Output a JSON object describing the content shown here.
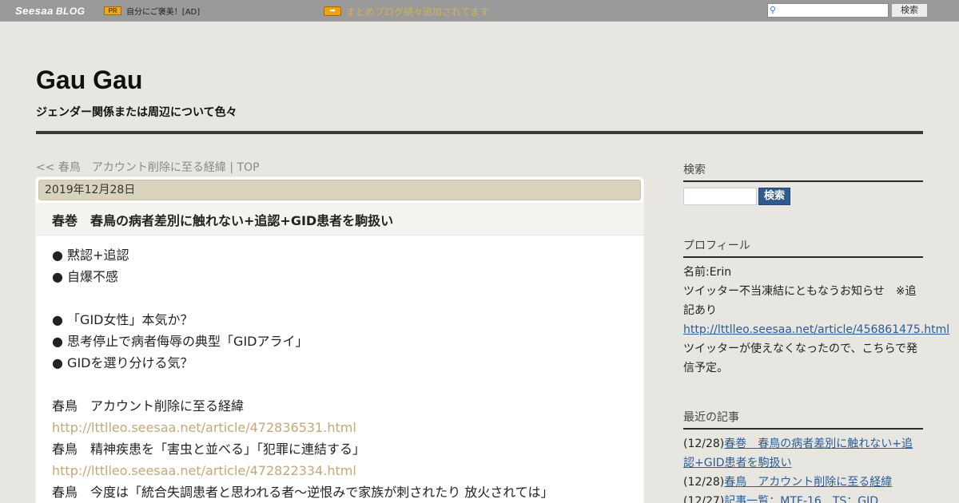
{
  "topbar": {
    "logo_main": "Seesaa",
    "logo_sub": "BLOG",
    "pr_label": "PR",
    "ad_text": "自分にご褒美！[AD]",
    "arrow_label": "➡",
    "notice": "まとめブログ続々追加されてます",
    "search_button": "検索",
    "search_value": ""
  },
  "header": {
    "title": "Gau Gau",
    "description": "ジェンダー関係または周辺について色々"
  },
  "nav": {
    "prev": "<< 春鳥　アカウント削除に至る経緯",
    "separator": " | ",
    "top": "TOP"
  },
  "article": {
    "date": "2019年12月28日",
    "title": "春巻　春鳥の病者差別に触れない+追認+GID患者を駒扱い",
    "lines": [
      {
        "text": "● 黙認+追認",
        "link": false
      },
      {
        "text": "● 自爆不感",
        "link": false
      },
      {
        "text": "",
        "link": false
      },
      {
        "text": "● 「GID女性」本気か？",
        "link": false
      },
      {
        "text": "● 思考停止で病者侮辱の典型「GIDアライ」",
        "link": false
      },
      {
        "text": "● GIDを選り分ける気？",
        "link": false
      },
      {
        "text": "",
        "link": false
      },
      {
        "text": "春鳥　アカウント削除に至る経緯",
        "link": false
      },
      {
        "text": "http://lttlleo.seesaa.net/article/472836531.html",
        "link": true
      },
      {
        "text": "春鳥　精神疾患を「害虫と並べる」「犯罪に連結する」",
        "link": false
      },
      {
        "text": "http://lttlleo.seesaa.net/article/472822334.html",
        "link": true
      },
      {
        "text": "春鳥　今度は「統合失調患者と思われる者～逆恨みで家族が刺されたり 放火されては」",
        "link": false
      }
    ]
  },
  "sidebar": {
    "search_heading": "検索",
    "search_button": "検索",
    "profile_heading": "プロフィール",
    "profile_name": "名前:Erin",
    "profile_notice": "ツイッター不当凍結にともなうお知らせ　※追記あり",
    "profile_link": "http://lttlleo.seesaa.net/article/456861475.html",
    "profile_note": "ツイッターが使えなくなったので、こちらで発信予定。",
    "recent_heading": "最近の記事",
    "recent": [
      {
        "date": "(12/28)",
        "title": "春巻　春鳥の病者差別に触れない+追認+GID患者を駒扱い"
      },
      {
        "date": "(12/28)",
        "title": "春鳥　アカウント削除に至る経緯"
      },
      {
        "date": "(12/27)",
        "title": "記事一覧：MTF-16　TS：GID"
      }
    ]
  }
}
